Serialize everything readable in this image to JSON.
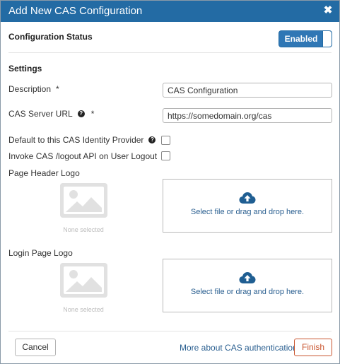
{
  "dialog": {
    "title": "Add New CAS Configuration",
    "close_glyph": "✖"
  },
  "status": {
    "label": "Configuration Status",
    "toggle_label": "Enabled",
    "enabled": true
  },
  "settings": {
    "heading": "Settings",
    "description": {
      "label": "Description",
      "required_mark": "*",
      "value": "CAS Configuration"
    },
    "server_url": {
      "label": "CAS Server URL",
      "help_glyph": "?",
      "required_mark": "*",
      "value": "https://somedomain.org/cas"
    },
    "default_provider": {
      "label": "Default to this CAS Identity Provider",
      "help_glyph": "?",
      "checked": false
    },
    "invoke_logout": {
      "label": "Invoke CAS /logout API on User Logout",
      "help_glyph": "?",
      "checked": false
    },
    "page_header_logo": {
      "label": "Page Header Logo",
      "preview_text": "None selected",
      "dropzone_text": "Select file or drag and drop here."
    },
    "login_page_logo": {
      "label": "Login Page Logo",
      "preview_text": "None selected",
      "dropzone_text": "Select file or drag and drop here."
    }
  },
  "footer": {
    "cancel_label": "Cancel",
    "more_link": "More about CAS authentication",
    "finish_label": "Finish"
  },
  "colors": {
    "header_bg": "#236ba4",
    "toggle_bg": "#2f77b5",
    "link": "#2a5f90",
    "finish_accent": "#c9552f"
  },
  "icons": {
    "close": "close-icon",
    "help": "help-icon",
    "image_placeholder": "image-placeholder-icon",
    "upload": "cloud-upload-icon"
  }
}
